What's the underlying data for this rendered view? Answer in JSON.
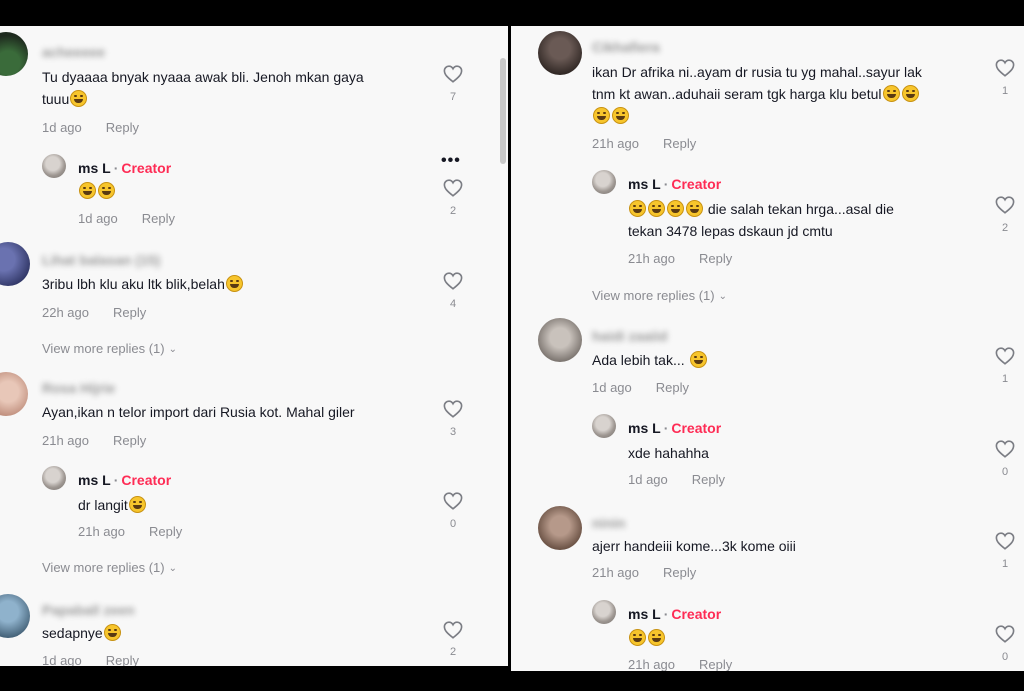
{
  "icons": {
    "like": "heart-outline-icon",
    "more": "more-options-icon",
    "expand": "chevron-down-icon",
    "emoji_laugh": "laughing-emoji-icon"
  },
  "colors": {
    "creator": "#fe2c55",
    "meta": "#8a8b91",
    "background": "#f8f8f8"
  },
  "left_panel": {
    "c1": {
      "username": "acheeeee",
      "text": "Tu dyaaaa bnyak nyaaa awak bli. Jenoh mkan gaya",
      "text2": "tuuu",
      "time": "1d ago",
      "reply": "Reply",
      "likes": "7"
    },
    "r1": {
      "author": "ms L",
      "sep": "·",
      "badge": "Creator",
      "time": "1d ago",
      "reply": "Reply",
      "likes": "2"
    },
    "c2": {
      "username": "Lihat balasan (15)",
      "text": "3ribu lbh klu aku ltk blik,belah",
      "time": "22h ago",
      "reply": "Reply",
      "likes": "4",
      "view_more": "View more replies (1)"
    },
    "c3": {
      "username": "Rosa Hijrie",
      "text": "Ayan,ikan n telor import dari Rusia kot. Mahal giler",
      "time": "21h ago",
      "reply": "Reply",
      "likes": "3"
    },
    "r3": {
      "author": "ms L",
      "sep": "·",
      "badge": "Creator",
      "text": "dr langit",
      "time": "21h ago",
      "reply": "Reply",
      "likes": "0",
      "view_more": "View more replies (1)"
    },
    "c4": {
      "username": "Papaball zeen",
      "text": "sedapnye",
      "time": "1d ago",
      "reply": "Reply",
      "likes": "2"
    }
  },
  "right_panel": {
    "c1": {
      "username": "Cikhafiera",
      "text": "ikan Dr afrika ni..ayam dr rusia tu yg mahal..sayur lak",
      "text2": "tnm kt awan..aduhaii seram tgk harga klu betul",
      "time": "21h ago",
      "reply": "Reply",
      "likes": "1"
    },
    "r1": {
      "author": "ms L",
      "sep": "·",
      "badge": "Creator",
      "text": "die salah tekan hrga...asal die",
      "text2": "tekan 3478 lepas dskaun jd cmtu",
      "time": "21h ago",
      "reply": "Reply",
      "likes": "2",
      "view_more": "View more replies (1)"
    },
    "c2": {
      "username": "haidi zaaiid",
      "text": "Ada lebih tak...",
      "time": "1d ago",
      "reply": "Reply",
      "likes": "1"
    },
    "r2": {
      "author": "ms L",
      "sep": "·",
      "badge": "Creator",
      "text": "xde hahahha",
      "time": "1d ago",
      "reply": "Reply",
      "likes": "0"
    },
    "c3": {
      "username": "ninin",
      "text": "ajerr handeiii kome...3k kome oiii",
      "time": "21h ago",
      "reply": "Reply",
      "likes": "1"
    },
    "r3": {
      "author": "ms L",
      "sep": "·",
      "badge": "Creator",
      "time": "21h ago",
      "reply": "Reply",
      "likes": "0"
    }
  }
}
